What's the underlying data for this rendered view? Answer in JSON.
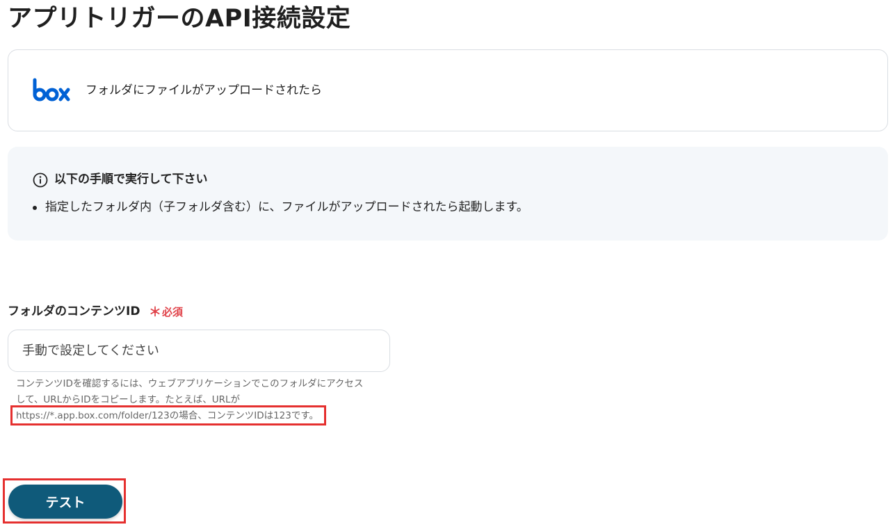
{
  "header": {
    "title": "アプリトリガーのAPI接続設定"
  },
  "trigger": {
    "logo_icon": "box-logo-icon",
    "brand_color": "#0061d5",
    "label": "フォルダにファイルがアップロードされたら"
  },
  "info": {
    "icon": "info-circle-icon",
    "heading": "以下の手順で実行して下さい",
    "bullets": [
      "指定したフォルダ内（子フォルダ含む）に、ファイルがアップロードされたら起動します。"
    ]
  },
  "form": {
    "field_label": "フォルダのコンテンツID",
    "required_mark": "＊",
    "required_text": "必須",
    "required_color": "#e0434a",
    "input_value": "",
    "input_placeholder": "手動で設定してください",
    "help_lines": [
      "コンテンツIDを確認するには、ウェブアプリケーションでこのフォルダにアクセス",
      "して、URLからIDをコピーします。たとえば、URLが",
      "https://*.app.box.com/folder/123の場合、コンテンツIDは123です。"
    ]
  },
  "actions": {
    "test_label": "テスト",
    "button_color": "#0f5a7a",
    "highlight_color": "#e5302f"
  }
}
